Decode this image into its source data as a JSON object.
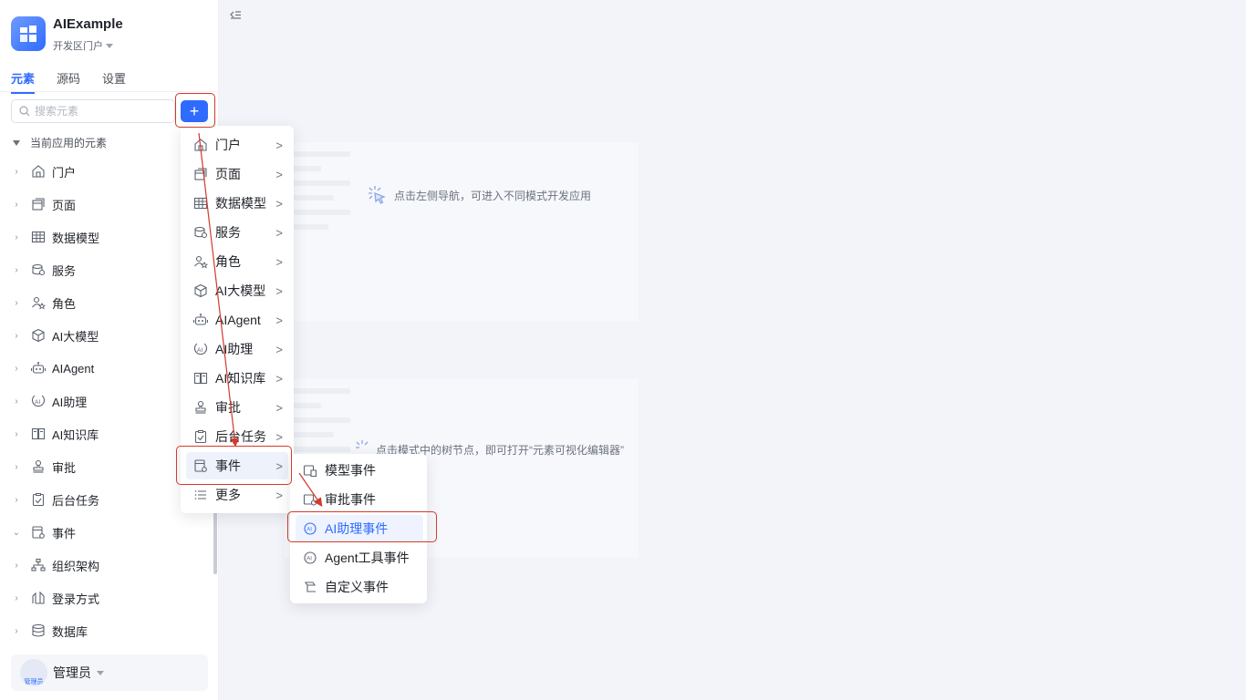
{
  "app": {
    "name": "AIExample",
    "portal": "开发区门户"
  },
  "tabs": [
    {
      "label": "元素"
    },
    {
      "label": "源码"
    },
    {
      "label": "设置"
    }
  ],
  "search": {
    "placeholder": "搜索元素"
  },
  "add_button": {
    "label": "+"
  },
  "tree": {
    "header": "当前应用的元素",
    "items": [
      {
        "label": "门户",
        "icon": "home-icon"
      },
      {
        "label": "页面",
        "icon": "page-icon"
      },
      {
        "label": "数据模型",
        "icon": "table-icon"
      },
      {
        "label": "服务",
        "icon": "database-icon"
      },
      {
        "label": "角色",
        "icon": "role-icon"
      },
      {
        "label": "AI大模型",
        "icon": "cube-icon"
      },
      {
        "label": "AIAgent",
        "icon": "robot-icon"
      },
      {
        "label": "AI助理",
        "icon": "ai-assistant-icon"
      },
      {
        "label": "AI知识库",
        "icon": "book-icon"
      },
      {
        "label": "审批",
        "icon": "stamp-icon"
      },
      {
        "label": "后台任务",
        "icon": "task-icon"
      },
      {
        "label": "事件",
        "icon": "event-icon"
      },
      {
        "label": "组织架构",
        "icon": "org-icon"
      },
      {
        "label": "登录方式",
        "icon": "login-icon"
      },
      {
        "label": "数据库",
        "icon": "db-icon"
      }
    ]
  },
  "user": {
    "name": "管理员",
    "avatar_text": "管理员"
  },
  "main": {
    "hint_nav": "点击左侧导航，可进入不同模式开发应用",
    "hint_tree": "点击模式中的树节点，即可打开“元素可视化编辑器”"
  },
  "add_menu": {
    "items": [
      {
        "label": "门户",
        "icon": "home-icon"
      },
      {
        "label": "页面",
        "icon": "page-icon"
      },
      {
        "label": "数据模型",
        "icon": "table-icon"
      },
      {
        "label": "服务",
        "icon": "database-icon"
      },
      {
        "label": "角色",
        "icon": "role-icon"
      },
      {
        "label": "AI大模型",
        "icon": "cube-icon"
      },
      {
        "label": "AIAgent",
        "icon": "robot-icon"
      },
      {
        "label": "AI助理",
        "icon": "ai-assistant-icon"
      },
      {
        "label": "AI知识库",
        "icon": "book-icon"
      },
      {
        "label": "审批",
        "icon": "stamp-icon"
      },
      {
        "label": "后台任务",
        "icon": "task-icon"
      },
      {
        "label": "事件",
        "icon": "event-icon"
      },
      {
        "label": "更多",
        "icon": "list-icon"
      }
    ],
    "arrow": ">"
  },
  "event_menu": {
    "items": [
      {
        "label": "模型事件",
        "icon": "model-event-icon"
      },
      {
        "label": "审批事件",
        "icon": "approval-event-icon"
      },
      {
        "label": "AI助理事件",
        "icon": "ai-event-icon"
      },
      {
        "label": "Agent工具事件",
        "icon": "agent-event-icon"
      },
      {
        "label": "自定义事件",
        "icon": "custom-event-icon"
      }
    ],
    "selected": "AI助理事件"
  },
  "colors": {
    "accent": "#2f6bff",
    "annotation": "#d23a2b"
  }
}
